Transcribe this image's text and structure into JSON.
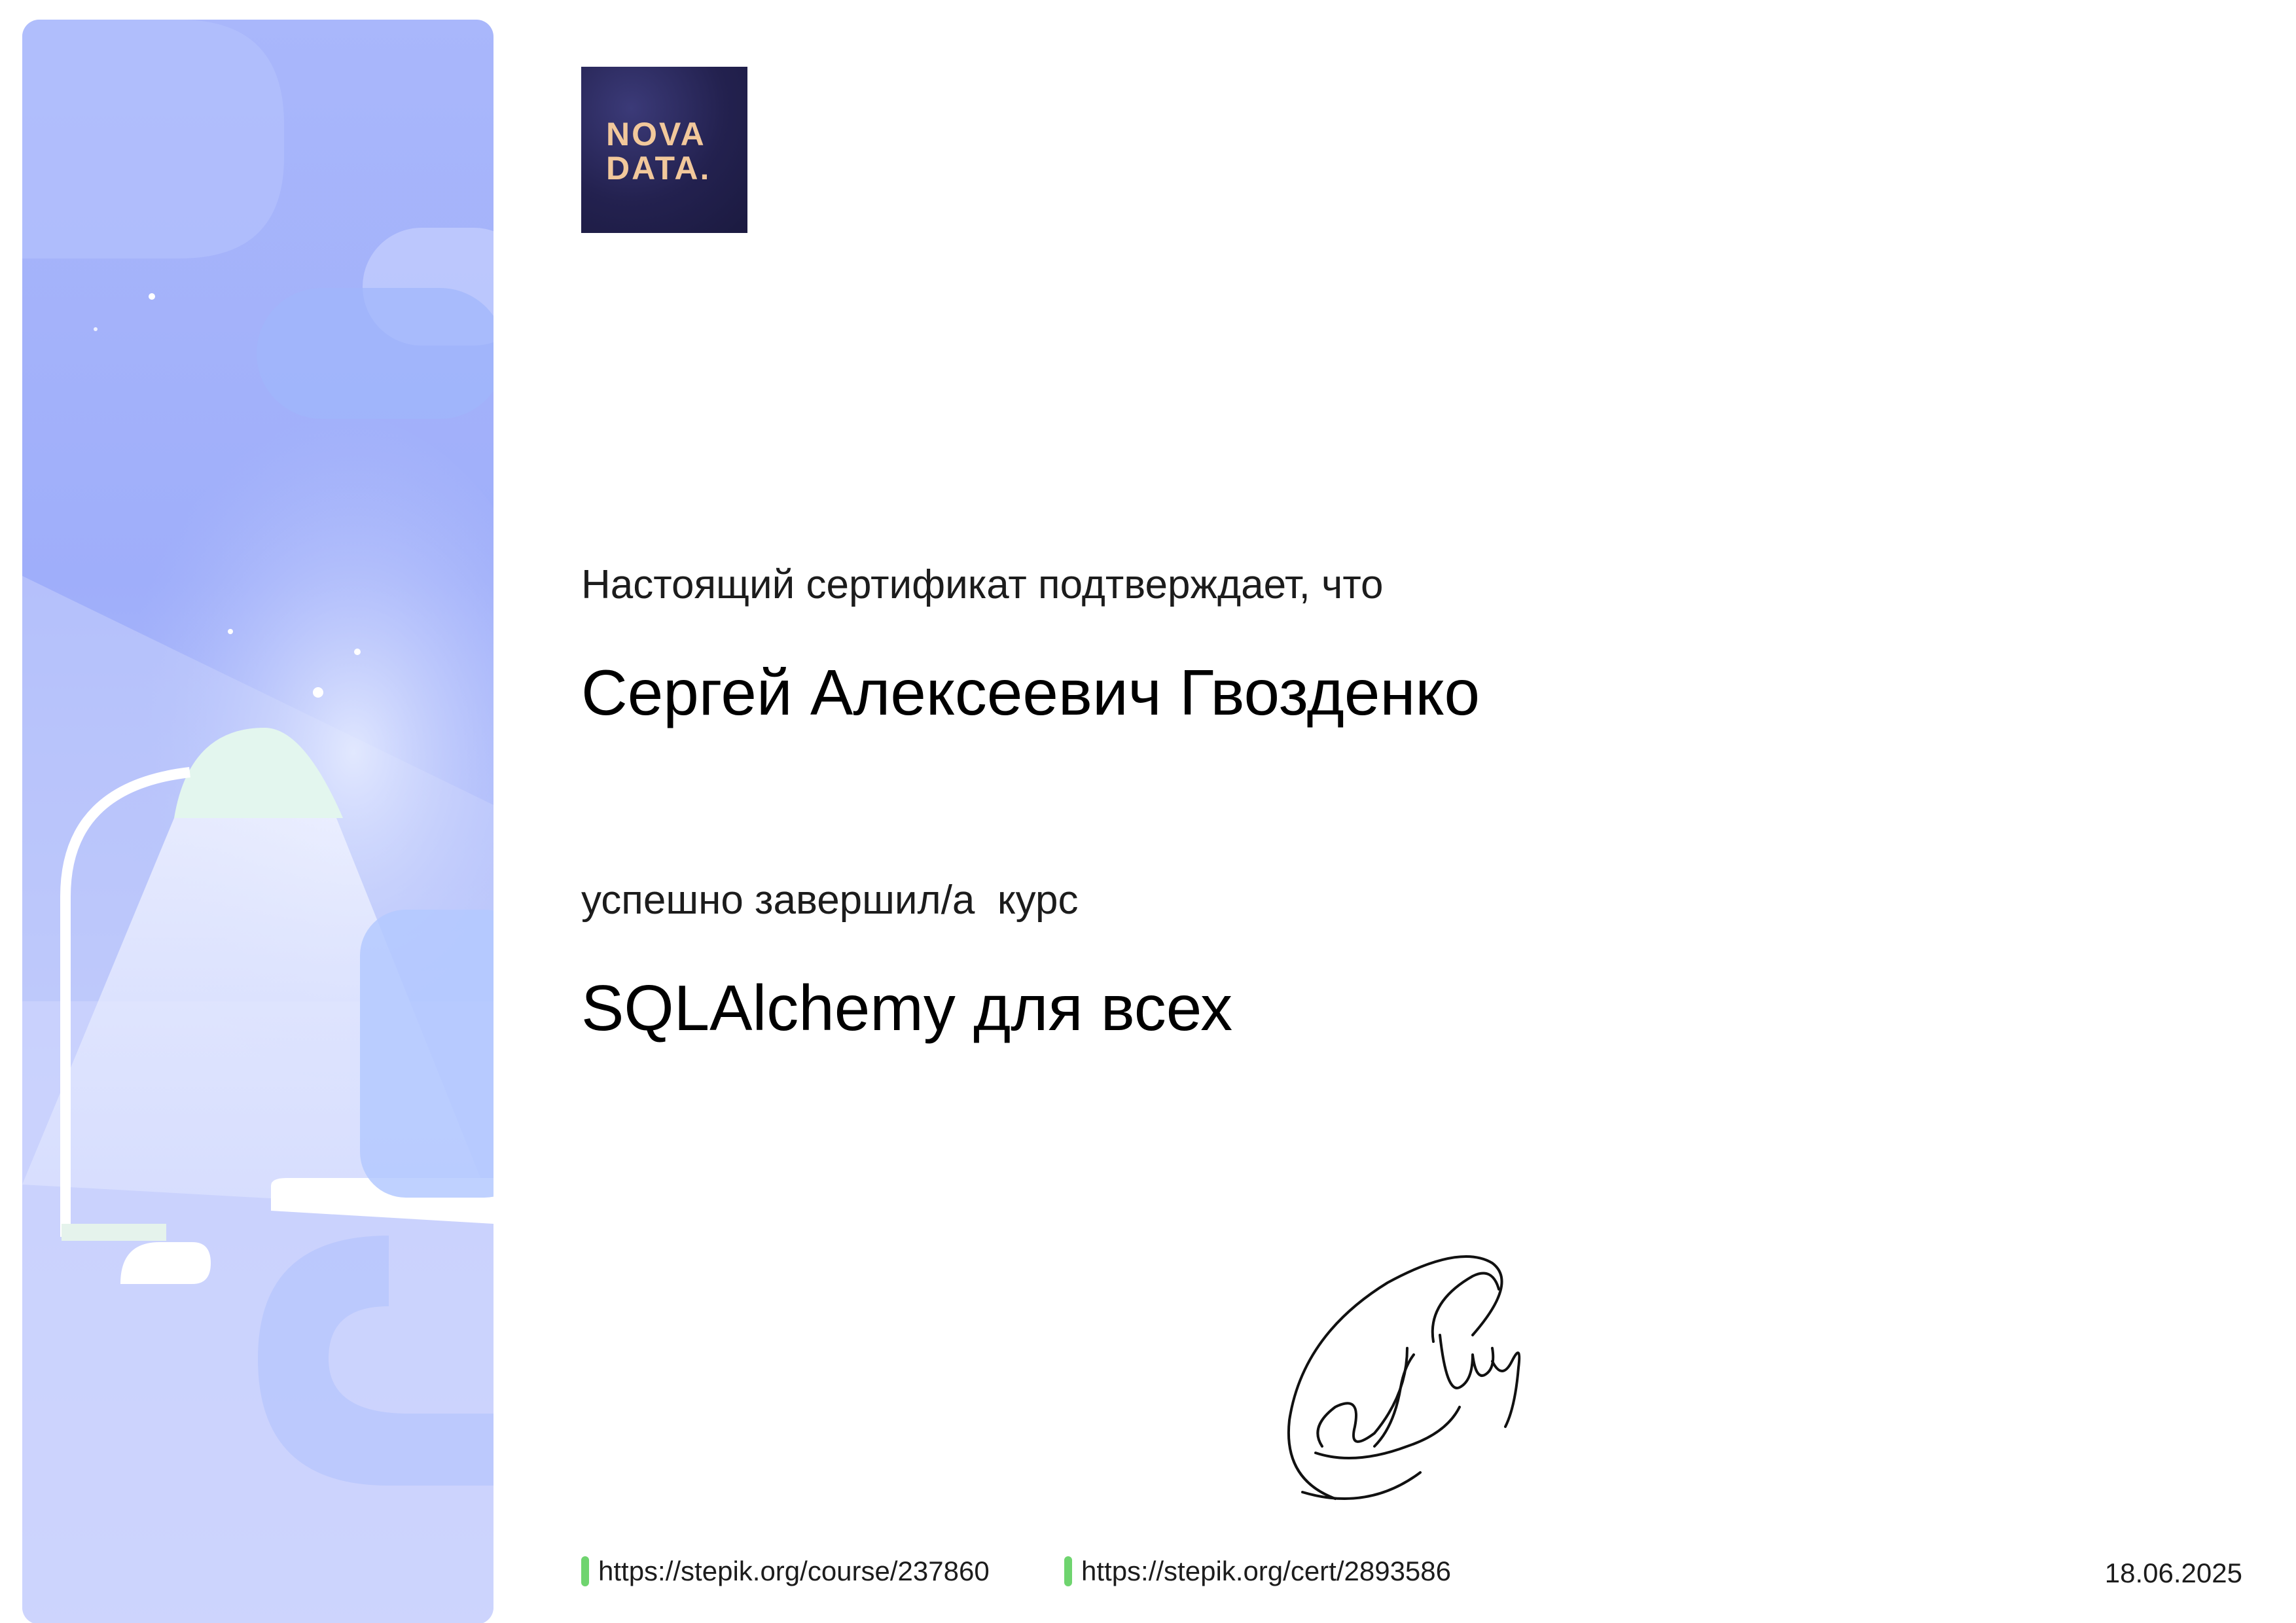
{
  "logo": {
    "line1": "NOVA",
    "line2": "DATA."
  },
  "certificate": {
    "intro": "Настоящий сертификат подтверждает, что",
    "recipient": "Сергей Алексеевич Гвозденко",
    "completed_label": "успешно завершил/а  курс",
    "course_title": "SQLAlchemy для всех"
  },
  "footer": {
    "course_link": "https://stepik.org/course/237860",
    "cert_link": "https://stepik.org/cert/2893586",
    "date": "18.06.2025"
  },
  "colors": {
    "side_art_primary": "#a9b7fb",
    "logo_background": "#23214f",
    "logo_text": "#f2c89b",
    "link_marker": "#6fd46f"
  },
  "icons": {
    "link_marker": "green-bar-icon",
    "signature": "handwritten-signature"
  }
}
